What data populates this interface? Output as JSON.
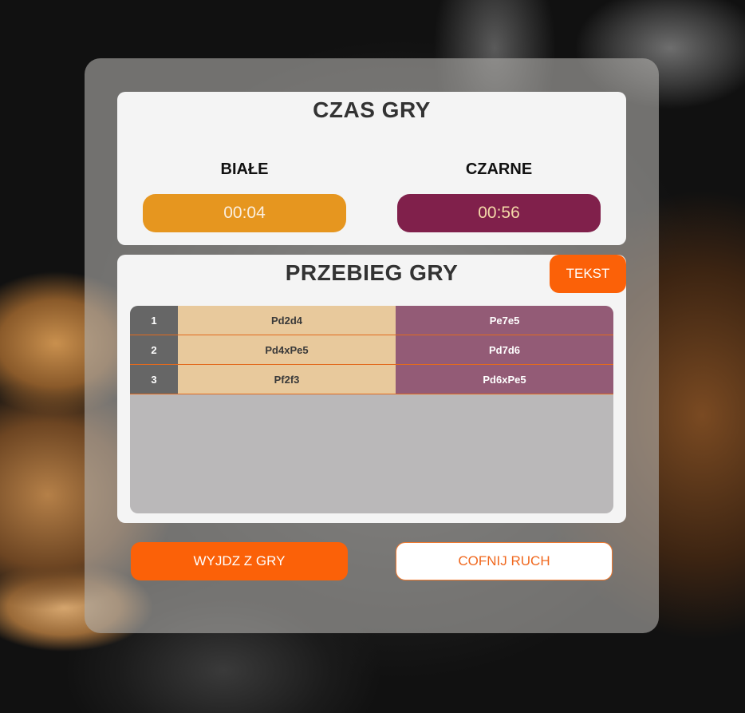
{
  "timer": {
    "title": "CZAS GRY",
    "white_label": "BIAŁE",
    "black_label": "CZARNE",
    "white_time": "00:04",
    "black_time": "00:56"
  },
  "history": {
    "title": "PRZEBIEG GRY",
    "text_button": "TEKST",
    "moves": [
      {
        "num": "1",
        "white": "Pd2d4",
        "black": "Pe7e5"
      },
      {
        "num": "2",
        "white": "Pd4xPe5",
        "black": "Pd7d6"
      },
      {
        "num": "3",
        "white": "Pf2f3",
        "black": "Pd6xPe5"
      }
    ]
  },
  "actions": {
    "exit_label": "WYJDZ Z GRY",
    "undo_label": "COFNIJ RUCH"
  },
  "colors": {
    "accent": "#fb6108",
    "white_clock": "#e6961f",
    "black_clock": "#80204b",
    "white_move_cell": "#e8c99c",
    "black_move_cell": "#935b76"
  }
}
